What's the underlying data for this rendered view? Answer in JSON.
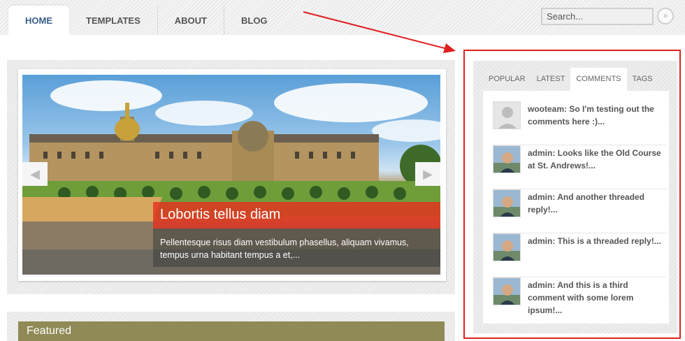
{
  "nav": {
    "items": [
      {
        "label": "HOME",
        "active": true
      },
      {
        "label": "TEMPLATES",
        "active": false
      },
      {
        "label": "ABOUT",
        "active": false
      },
      {
        "label": "BLOG",
        "active": false
      }
    ]
  },
  "search": {
    "placeholder": "Search...",
    "button_icon": "double-chevron-right-icon"
  },
  "slider": {
    "title": "Lobortis tellus diam",
    "body": "Pellentesque risus diam vestibulum phasellus, aliquam vivamus, tempus urna habitant tempus a et,...",
    "prev_icon": "triangle-left-icon",
    "next_icon": "triangle-right-icon"
  },
  "featured": {
    "title": "Featured"
  },
  "sidebar": {
    "tabs": [
      {
        "label": "POPULAR",
        "active": false
      },
      {
        "label": "LATEST",
        "active": false
      },
      {
        "label": "COMMENTS",
        "active": true
      },
      {
        "label": "TAGS",
        "active": false
      }
    ],
    "comments": [
      {
        "text": "wooteam: So I'm testing out the comments here :)...",
        "avatar": "placeholder"
      },
      {
        "text": "admin: Looks like the Old Course at St. Andrews!...",
        "avatar": "photo"
      },
      {
        "text": "admin: And another threaded reply!...",
        "avatar": "photo"
      },
      {
        "text": "admin: This is a threaded reply!...",
        "avatar": "photo"
      },
      {
        "text": "admin: And this is a third comment with some lorem ipsum!...",
        "avatar": "photo"
      }
    ]
  },
  "colors": {
    "highlight": "#e02020",
    "caption_red": "#e4321e",
    "featured_bar": "#8f8a56",
    "nav_active": "#3a5f8a"
  }
}
